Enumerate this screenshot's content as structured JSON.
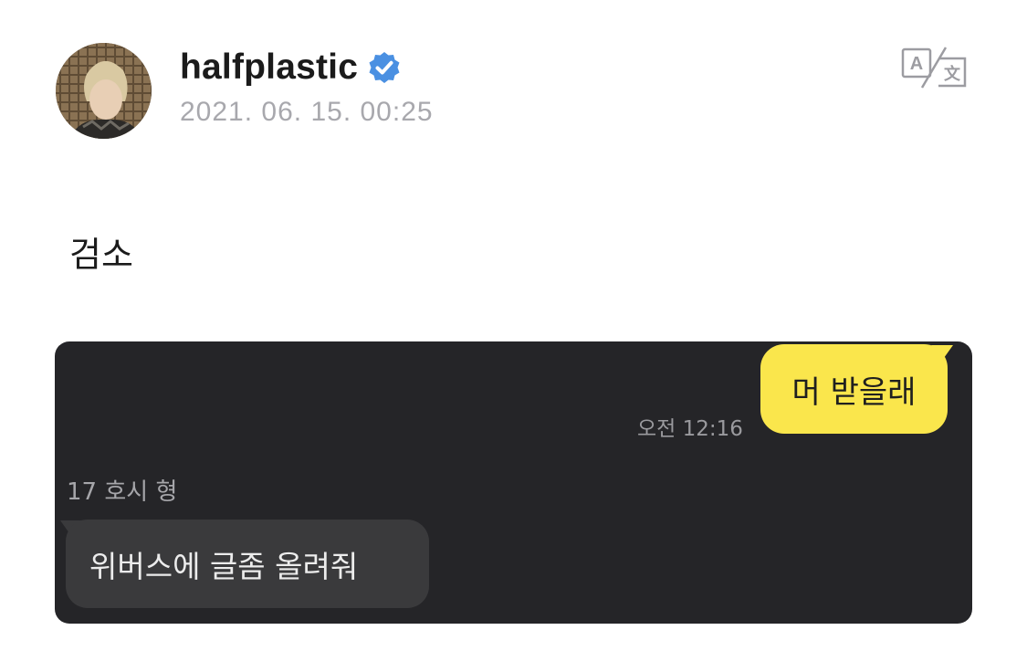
{
  "post": {
    "author": "halfplastic",
    "timestamp": "2021. 06. 15. 00:25",
    "text": "검소",
    "icons": {
      "verified": "verified-badge-icon",
      "translate": "translate-icon",
      "avatar": "profile-avatar"
    }
  },
  "chat": {
    "outgoing": {
      "text": "머 받을래",
      "time": "오전 12:16"
    },
    "incoming": {
      "sender": "17 호시 형",
      "text": "위버스에 글좀 올려줘"
    }
  },
  "colors": {
    "verified": "#4a90e2",
    "outgoing_bubble": "#fae64c",
    "chat_background": "#252528",
    "incoming_bubble": "#3a3a3c",
    "timestamp_text": "#a8a8ad"
  }
}
